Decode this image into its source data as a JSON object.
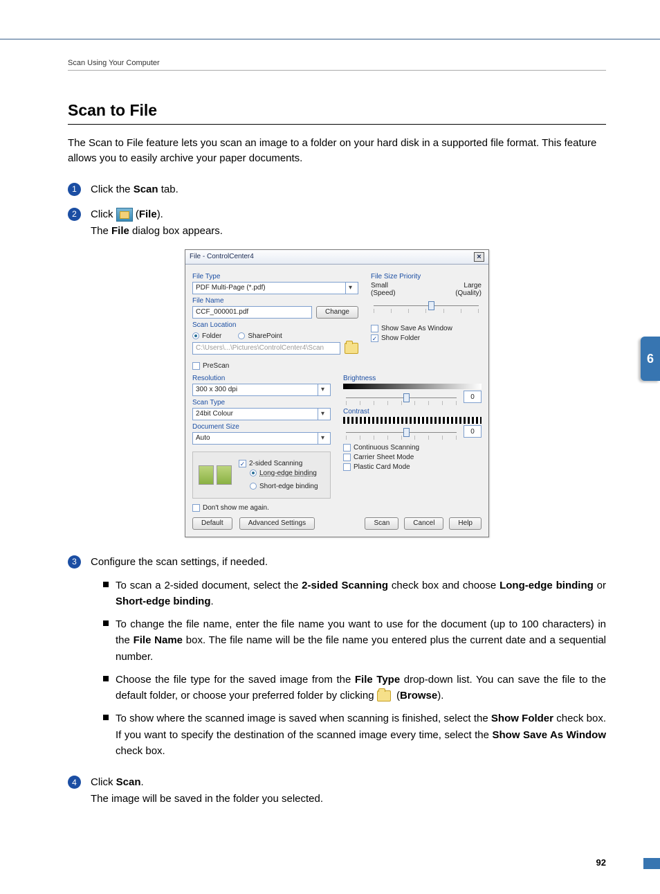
{
  "runningHeader": "Scan Using Your Computer",
  "title": "Scan to File",
  "intro": "The Scan to File feature lets you scan an image to a folder on your hard disk in a supported file format. This feature allows you to easily archive your paper documents.",
  "chapterTab": "6",
  "pageNumber": "92",
  "steps": {
    "1": {
      "p1a": "Click the ",
      "p1b": "Scan",
      "p1c": " tab."
    },
    "2": {
      "p1a": "Click ",
      "p1b": "File",
      "p2": "The ",
      "p2b": "File",
      "p2c": " dialog box appears."
    },
    "3": {
      "intro": "Configure the scan settings, if needed.",
      "b1a": "To scan a 2-sided document, select the ",
      "b1b": "2-sided Scanning",
      "b1c": " check box and choose ",
      "b1d": "Long-edge binding",
      "b1e": " or ",
      "b1f": "Short-edge binding",
      "b1g": ".",
      "b2a": "To change the file name, enter the file name you want to use for the document (up to 100 characters) in the ",
      "b2b": "File Name",
      "b2c": " box. The file name will be the file name you entered plus the current date and a sequential number.",
      "b3a": "Choose the file type for the saved image from the ",
      "b3b": "File Type",
      "b3c": " drop-down list. You can save the file to the default folder, or choose your preferred folder by clicking ",
      "b3d": "Browse",
      "b4a": "To show where the scanned image is saved when scanning is finished, select the ",
      "b4b": "Show Folder",
      "b4c": " check box. If you want to specify the destination of the scanned image every time, select the ",
      "b4d": "Show Save As Window",
      "b4e": " check box."
    },
    "4": {
      "p1a": "Click ",
      "p1b": "Scan",
      "p2": "The image will be saved in the folder you selected."
    }
  },
  "dialog": {
    "title": "File - ControlCenter4",
    "fileType": {
      "label": "File Type",
      "value": "PDF Multi-Page (*.pdf)"
    },
    "fileName": {
      "label": "File Name",
      "value": "CCF_000001.pdf",
      "changeBtn": "Change"
    },
    "scanLocation": {
      "label": "Scan Location",
      "folder": "Folder",
      "sharepoint": "SharePoint",
      "path": "C:\\Users\\...\\Pictures\\ControlCenter4\\Scan"
    },
    "fileSize": {
      "label": "File Size Priority",
      "small": "Small",
      "large": "Large",
      "speed": "(Speed)",
      "quality": "(Quality)"
    },
    "showSaveAs": "Show Save As Window",
    "showFolder": "Show Folder",
    "prescan": "PreScan",
    "resolution": {
      "label": "Resolution",
      "value": "300 x 300 dpi"
    },
    "scanType": {
      "label": "Scan Type",
      "value": "24bit Colour"
    },
    "docSize": {
      "label": "Document Size",
      "value": "Auto"
    },
    "twoSided": "2-sided Scanning",
    "longEdge": "Long-edge binding",
    "shortEdge": "Short-edge binding",
    "brightness": {
      "label": "Brightness",
      "val": "0"
    },
    "contrast": {
      "label": "Contrast",
      "val": "0"
    },
    "contScan": "Continuous Scanning",
    "carrier": "Carrier Sheet Mode",
    "plastic": "Plastic Card Mode",
    "dontShow": "Don't show me again.",
    "defaultBtn": "Default",
    "advBtn": "Advanced Settings",
    "scanBtn": "Scan",
    "cancelBtn": "Cancel",
    "helpBtn": "Help"
  }
}
